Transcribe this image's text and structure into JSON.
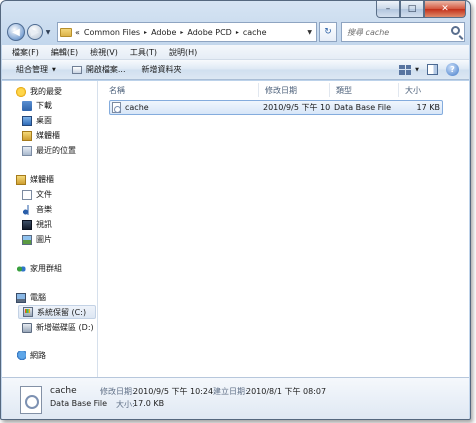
{
  "window": {
    "caption": {
      "minimize": "–",
      "maximize": "□",
      "close": "✕"
    }
  },
  "nav": {
    "back": "◀",
    "forward": "▶",
    "history_dropdown": "▼",
    "breadcrumb_prefix": "«",
    "breadcrumbs": [
      "Common Files",
      "Adobe",
      "Adobe PCD",
      "cache"
    ],
    "separator": "▸",
    "address_dropdown": "▼",
    "refresh": "↻",
    "search_placeholder": "搜尋 cache"
  },
  "menubar": {
    "items": [
      "檔案(F)",
      "編輯(E)",
      "檢視(V)",
      "工具(T)",
      "說明(H)"
    ]
  },
  "commandbar": {
    "organize": "組合管理",
    "open": "開啟檔案...",
    "new_folder": "新增資料夾",
    "dropdown_arrow": "▼",
    "help": "?"
  },
  "sidebar": {
    "favorites": {
      "label": "我的最愛",
      "items": [
        "下載",
        "桌面",
        "媒體櫃",
        "最近的位置"
      ]
    },
    "libraries": {
      "label": "媒體櫃",
      "items": [
        "文件",
        "音樂",
        "視訊",
        "圖片"
      ]
    },
    "homegroup": {
      "label": "家用群組"
    },
    "computer": {
      "label": "電腦",
      "items": [
        "系統保留 (C:)",
        "新增磁碟區 (D:)"
      ]
    },
    "network": {
      "label": "網路"
    }
  },
  "filelist": {
    "columns": [
      "名稱",
      "修改日期",
      "類型",
      "大小"
    ],
    "rows": [
      {
        "name": "cache",
        "modified": "2010/9/5 下午 10...",
        "type": "Data Base File",
        "size": "17 KB"
      }
    ]
  },
  "details": {
    "filename": "cache",
    "filetype": "Data Base File",
    "modified_label": "修改日期:",
    "modified_value": "2010/9/5 下午 10:24",
    "created_label": "建立日期:",
    "created_value": "2010/8/1 下午 08:07",
    "size_label": "大小:",
    "size_value": "17.0 KB"
  }
}
